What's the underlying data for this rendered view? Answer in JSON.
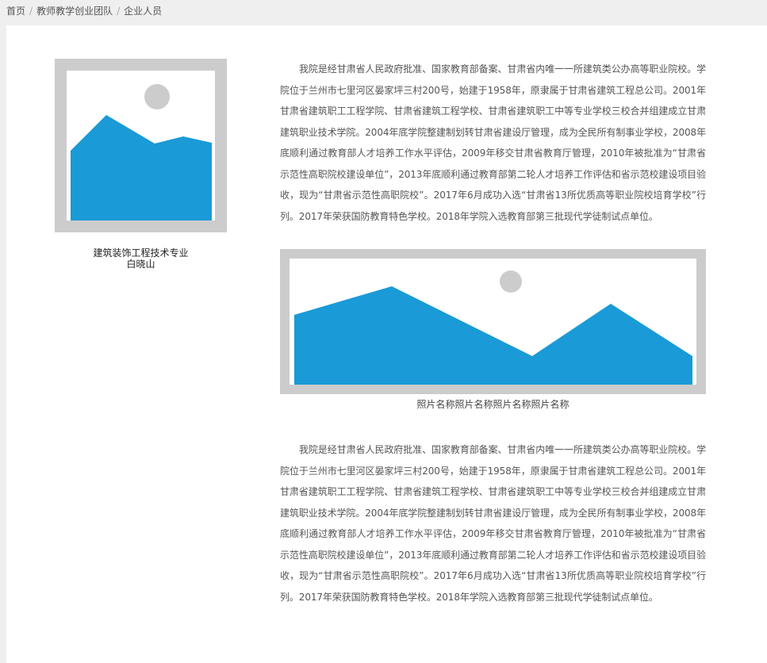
{
  "breadcrumb": {
    "items": [
      "首页",
      "教师教学创业团队",
      "企业人员"
    ],
    "separator": "/"
  },
  "profile": {
    "image_icon": "image-placeholder-icon",
    "major": "建筑装饰工程技术专业",
    "name": "白晓山"
  },
  "content": {
    "paragraph1": "我院是经甘肃省人民政府批准、国家教育部备案、甘肃省内唯一一所建筑类公办高等职业院校。学院位于兰州市七里河区晏家坪三村200号，始建于1958年，原隶属于甘肃省建筑工程总公司。2001年甘肃省建筑职工工程学院、甘肃省建筑工程学校、甘肃省建筑职工中等专业学校三校合并组建成立甘肃建筑职业技术学院。2004年底学院整建制划转甘肃省建设厅管理，成为全民所有制事业学校，2008年底顺利通过教育部人才培养工作水平评估，2009年移交甘肃省教育厅管理，2010年被批准为“甘肃省示范性高职院校建设单位”，2013年底顺利通过教育部第二轮人才培养工作评估和省示范校建设项目验收，现为“甘肃省示范性高职院校”。2017年6月成功入选“甘肃省13所优质高等职业院校培育学校”行列。2017年荣获国防教育特色学校。2018年学院入选教育部第三批现代学徒制试点单位。",
    "photo_icon": "image-placeholder-icon",
    "photo_caption": "照片名称照片名称照片名称照片名称",
    "paragraph2": "我院是经甘肃省人民政府批准、国家教育部备案、甘肃省内唯一一所建筑类公办高等职业院校。学院位于兰州市七里河区晏家坪三村200号，始建于1958年，原隶属于甘肃省建筑工程总公司。2001年甘肃省建筑职工工程学院、甘肃省建筑工程学校、甘肃省建筑职工中等专业学校三校合并组建成立甘肃建筑职业技术学院。2004年底学院整建制划转甘肃省建设厅管理，成为全民所有制事业学校，2008年底顺利通过教育部人才培养工作水平评估，2009年移交甘肃省教育厅管理，2010年被批准为“甘肃省示范性高职院校建设单位”，2013年底顺利通过教育部第二轮人才培养工作评估和省示范校建设项目验收，现为“甘肃省示范性高职院校”。2017年6月成功入选“甘肃省13所优质高等职业院校培育学校”行列。2017年荣获国防教育特色学校。2018年学院入选教育部第三批现代学徒制试点单位。"
  },
  "colors": {
    "page_bg": "#efefef",
    "card_bg": "#ffffff",
    "placeholder_frame": "#cccccc",
    "mountain": "#1a9ad6",
    "sun": "#cccccc"
  }
}
